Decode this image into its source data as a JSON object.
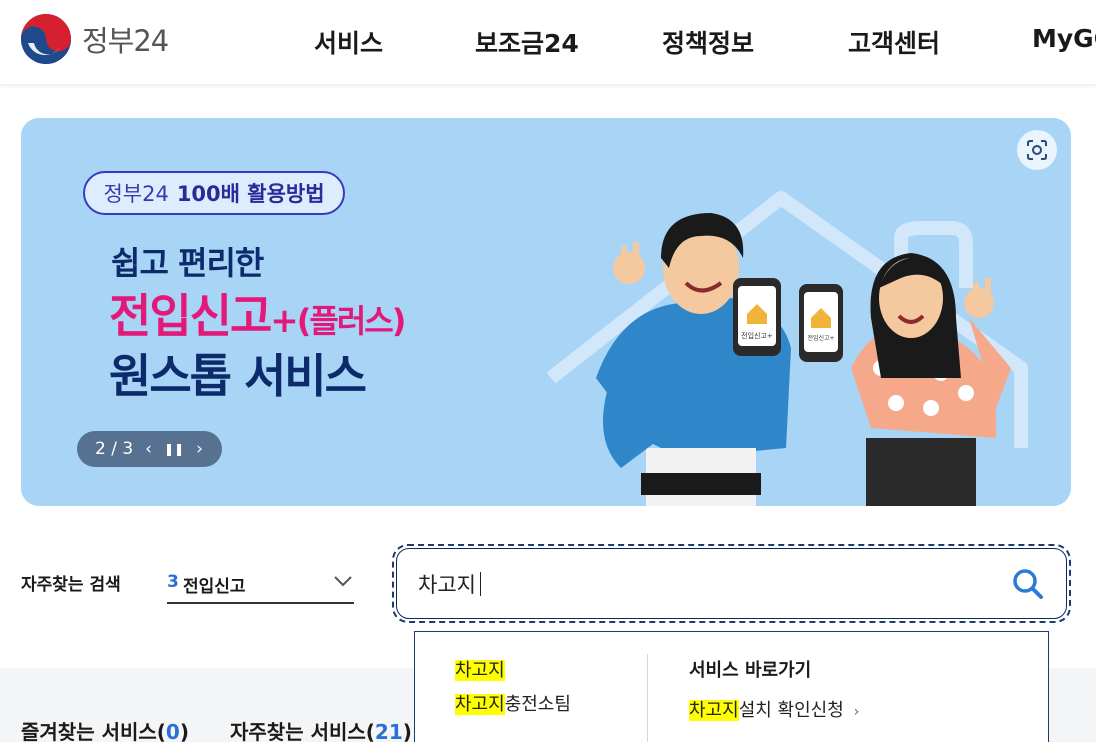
{
  "header": {
    "logo_text": "정부24",
    "nav": [
      {
        "label": "서비스"
      },
      {
        "label": "보조금24"
      },
      {
        "label": "정책정보"
      },
      {
        "label": "고객센터"
      },
      {
        "label": "MyGOV"
      }
    ]
  },
  "banner": {
    "pill_brand": "정부24",
    "pill_text": "100배 활용방법",
    "headline_1": "쉽고 편리한",
    "headline_2_main": "전입신고",
    "headline_2_plus": "+",
    "headline_2_sub": "(플러스)",
    "headline_3": "원스톱 서비스",
    "phone_label": "전입신고+",
    "slide_counter": "2 / 3",
    "colors": {
      "background": "#a8d4f6",
      "accent": "#e3197a",
      "navy": "#0d2b6b"
    }
  },
  "search": {
    "frequent_label": "자주찾는 검색",
    "frequent_rank": "3",
    "frequent_term": "전입신고",
    "query": "차고지",
    "autocomplete": {
      "suggestions": [
        {
          "highlight": "차고지",
          "rest": ""
        },
        {
          "highlight": "차고지",
          "rest": "충전소팀"
        }
      ],
      "shortcut_header": "서비스 바로가기",
      "shortcuts": [
        {
          "highlight": "차고지",
          "rest": "설치 확인신청"
        }
      ]
    }
  },
  "tabs": {
    "favorites_label": "즐겨찾는 서비스",
    "favorites_count": "0",
    "frequent_label": "자주찾는 서비스",
    "frequent_count": "21"
  }
}
